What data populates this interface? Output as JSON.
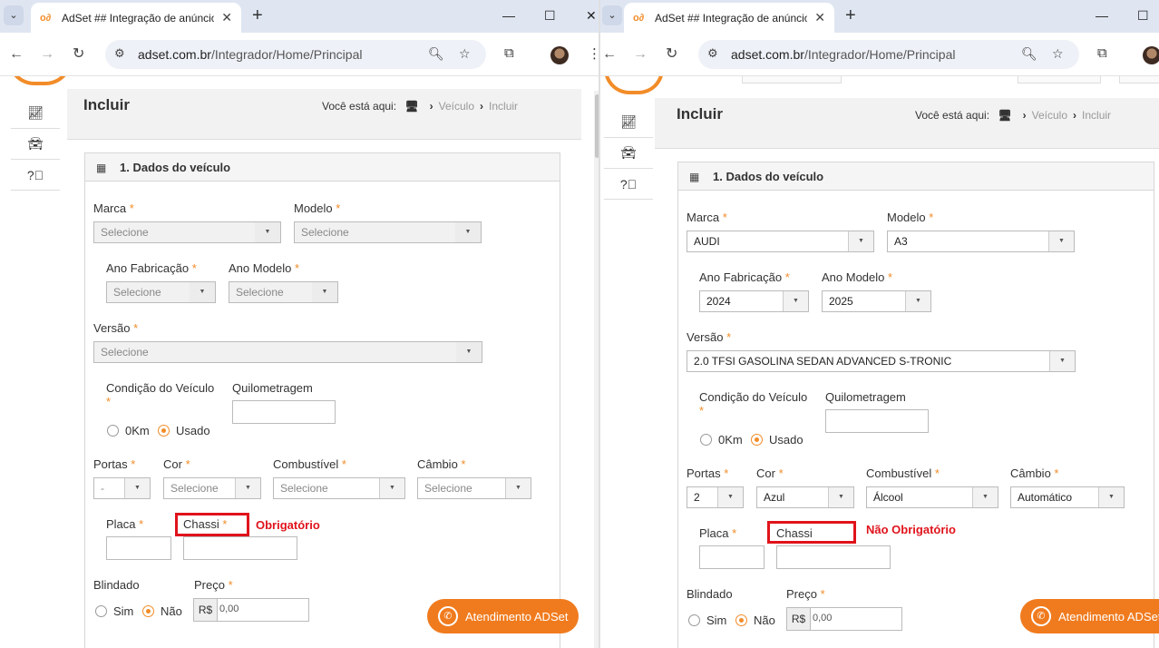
{
  "browser": {
    "tab_title": "AdSet ## Integração de anúncios",
    "url_host": "adset.com.br",
    "url_path": "/Integrador/Home/Principal",
    "icons": [
      "tab-list-icon",
      "close-icon",
      "plus-icon",
      "minimize-icon",
      "maximize-icon",
      "back-icon",
      "forward-icon",
      "reload-icon",
      "site-info-icon",
      "zoom-icon",
      "star-icon",
      "extensions-icon",
      "menu-icon"
    ]
  },
  "page": {
    "title": "Incluir",
    "breadcrumb_label": "Você está aqui:",
    "breadcrumb_items": [
      "Veículo",
      "Incluir"
    ],
    "panel_title": "1. Dados do veículo",
    "chat_label": "Atendimento ADSet"
  },
  "labels": {
    "marca": "Marca",
    "modelo": "Modelo",
    "ano_fab": "Ano Fabricação",
    "ano_modelo": "Ano Modelo",
    "versao": "Versão",
    "condicao": "Condição do Veículo",
    "km": "Quilometragem",
    "zero_km": "0Km",
    "usado": "Usado",
    "portas": "Portas",
    "cor": "Cor",
    "combustivel": "Combustível",
    "cambio": "Câmbio",
    "placa": "Placa",
    "chassi": "Chassi",
    "blindado": "Blindado",
    "sim": "Sim",
    "nao": "Não",
    "preco": "Preço",
    "currency": "R$",
    "req": "*"
  },
  "left": {
    "marca": "Selecione",
    "modelo": "Selecione",
    "ano_fab": "Selecione",
    "ano_modelo": "Selecione",
    "versao": "Selecione",
    "portas": "-",
    "cor": "Selecione",
    "combustivel": "Selecione",
    "cambio": "Selecione",
    "preco": "0,00",
    "annotation": "Obrigatório",
    "condicao": "usado",
    "blindado": "nao"
  },
  "right": {
    "marca": "AUDI",
    "modelo": "A3",
    "ano_fab": "2024",
    "ano_modelo": "2025",
    "versao": "2.0 TFSI GASOLINA SEDAN ADVANCED S-TRONIC",
    "portas": "2",
    "cor": "Azul",
    "combustivel": "Álcool",
    "cambio": "Automático",
    "preco": "0,00",
    "annotation": "Não Obrigatório",
    "condicao": "usado",
    "blindado": "nao"
  },
  "colors": {
    "accent": "#f28c28",
    "annotation": "#e0131b",
    "chat": "#f07b1e"
  }
}
